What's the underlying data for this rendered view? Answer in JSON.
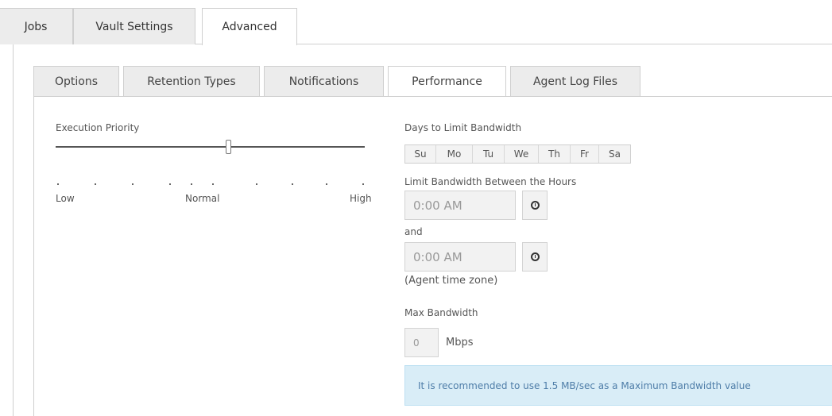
{
  "top_tabs": [
    "Jobs",
    "Vault Settings",
    "Advanced"
  ],
  "active_top_tab": "Advanced",
  "inner_tabs": [
    "Options",
    "Retention Types",
    "Notifications",
    "Performance",
    "Agent Log Files"
  ],
  "active_inner_tab": "Performance",
  "execution_priority": {
    "label": "Execution Priority",
    "low_label": "Low",
    "normal_label": "Normal",
    "high_label": "High"
  },
  "bandwidth": {
    "days_label": "Days to Limit Bandwidth",
    "days": [
      "Su",
      "Mo",
      "Tu",
      "We",
      "Th",
      "Fr",
      "Sa"
    ],
    "hours_label": "Limit Bandwidth Between the Hours",
    "start_time": "0:00 AM",
    "and_label": "and",
    "end_time": "0:00 AM",
    "timezone_note": "(Agent time zone)",
    "max_label": "Max Bandwidth",
    "max_value": "0",
    "unit": "Mbps",
    "recommendation": "It is recommended to use 1.5 MB/sec as a Maximum Bandwidth value"
  },
  "icons": {
    "time_picker": "clock-icon"
  }
}
